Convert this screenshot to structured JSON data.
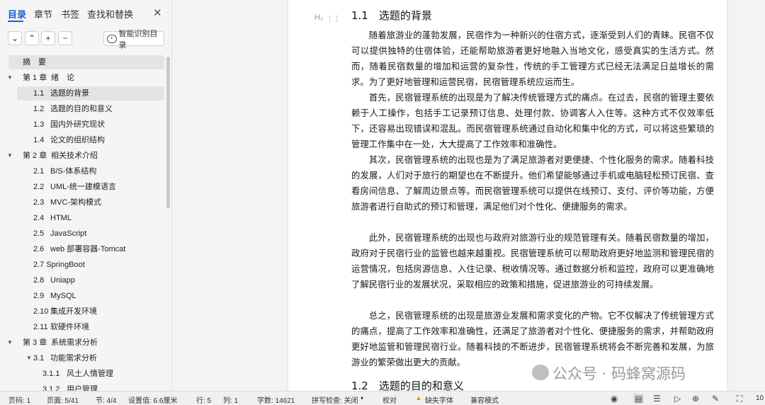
{
  "sidebar": {
    "tabs": [
      "目录",
      "章节",
      "书签",
      "查找和替换"
    ],
    "close": "✕",
    "smart_button": "智能识别目录",
    "toc": [
      {
        "num": "",
        "text": "摘　要",
        "indent": 0,
        "caret": false,
        "selected": false,
        "shaded": true
      },
      {
        "num": "第 1 章",
        "text": "绪　论",
        "indent": 1,
        "caret": true,
        "selected": false
      },
      {
        "num": "1.1",
        "text": "选题的背景",
        "indent": 2,
        "caret": false,
        "selected": true
      },
      {
        "num": "1.2",
        "text": "选题的目的和意义",
        "indent": 2,
        "caret": false,
        "selected": false
      },
      {
        "num": "1.3",
        "text": "国内外研究现状",
        "indent": 2,
        "caret": false,
        "selected": false
      },
      {
        "num": "1.4",
        "text": "论文的组织结构",
        "indent": 2,
        "caret": false,
        "selected": false
      },
      {
        "num": "第 2 章",
        "text": "相关技术介绍",
        "indent": 1,
        "caret": true,
        "selected": false
      },
      {
        "num": "2.1",
        "text": "B/S-体系结构",
        "indent": 2,
        "caret": false,
        "selected": false
      },
      {
        "num": "2.2",
        "text": "UML-统一建模语言",
        "indent": 2,
        "caret": false,
        "selected": false
      },
      {
        "num": "2.3",
        "text": "MVC-架构模式",
        "indent": 2,
        "caret": false,
        "selected": false
      },
      {
        "num": "2.4",
        "text": "HTML",
        "indent": 2,
        "caret": false,
        "selected": false
      },
      {
        "num": "2.5",
        "text": "JavaScript",
        "indent": 2,
        "caret": false,
        "selected": false
      },
      {
        "num": "2.6",
        "text": "web 部署容器-Tomcat",
        "indent": 2,
        "caret": false,
        "selected": false
      },
      {
        "num": "",
        "text": "2.7 SpringBoot",
        "indent": 2,
        "caret": false,
        "selected": false
      },
      {
        "num": "2.8",
        "text": "Uniapp",
        "indent": 2,
        "caret": false,
        "selected": false
      },
      {
        "num": "2.9",
        "text": "MySQL",
        "indent": 2,
        "caret": false,
        "selected": false
      },
      {
        "num": "2.10",
        "text": "集成开发环境",
        "indent": 2,
        "caret": false,
        "selected": false
      },
      {
        "num": "2.11",
        "text": "软硬件环境",
        "indent": 2,
        "caret": false,
        "selected": false
      },
      {
        "num": "第 3 章",
        "text": "系统需求分析",
        "indent": 1,
        "caret": true,
        "selected": false
      },
      {
        "num": "3.1",
        "text": "功能需求分析",
        "indent": 2,
        "caret": true,
        "selected": false
      },
      {
        "num": "3.1.1",
        "text": "风土人情管理",
        "indent": 3,
        "caret": false,
        "selected": false
      },
      {
        "num": "3.1.2",
        "text": "用户管理",
        "indent": 3,
        "caret": false,
        "selected": false
      }
    ]
  },
  "document": {
    "heading_marker": "H₂",
    "heading1": "1.1　选题的背景",
    "paragraphs": [
      "随着旅游业的蓬勃发展，民宿作为一种新兴的住宿方式，逐渐受到人们的青睐。民宿不仅可以提供独特的住宿体验，还能帮助旅游者更好地融入当地文化，感受真实的生活方式。然而，随着民宿数量的增加和运营的复杂性，传统的手工管理方式已经无法满足日益增长的需求。为了更好地管理和运营民宿，民宿管理系统应运而生。",
      "首先，民宿管理系统的出现是为了解决传统管理方式的痛点。在过去，民宿的管理主要依赖于人工操作，包括手工记录预订信息、处理付款、协调客人入住等。这种方式不仅效率低下，还容易出现错误和混乱。而民宿管理系统通过自动化和集中化的方式，可以将这些繁琐的管理工作集中在一处，大大提高了工作效率和准确性。",
      "其次，民宿管理系统的出现也是为了满足旅游者对更便捷、个性化服务的需求。随着科技的发展，人们对于旅行的期望也在不断提升。他们希望能够通过手机或电脑轻松预订民宿、查看房间信息、了解周边景点等。而民宿管理系统可以提供在线预订、支付、评价等功能，方便旅游者进行自助式的预订和管理，满足他们对个性化、便捷服务的需求。",
      "此外，民宿管理系统的出现也与政府对旅游行业的规范管理有关。随着民宿数量的增加，政府对于民宿行业的监管也越来越重视。民宿管理系统可以帮助政府更好地监测和管理民宿的运营情况，包括房源信息、入住记录、税收情况等。通过数据分析和监控，政府可以更准确地了解民宿行业的发展状况，采取相应的政策和措施，促进旅游业的可持续发展。",
      "总之，民宿管理系统的出现是旅游业发展和需求变化的产物。它不仅解决了传统管理方式的痛点，提高了工作效率和准确性，还满足了旅游者对个性化、便捷服务的需求，并帮助政府更好地监管和管理民宿行业。随着科技的不断进步，民宿管理系统将会不断完善和发展，为旅游业的繁荣做出更大的贡献。"
    ],
    "heading2": "1.2　选题的目的和意义",
    "watermark": "公众号 · 码蜂窝源码"
  },
  "status": {
    "page_code": "页码: 1",
    "page": "页面: 5/41",
    "section": "节: 4/4",
    "setting": "设置值: 6.6厘米",
    "row": "行: 5",
    "col": "列: 1",
    "words": "字数: 14621",
    "spell": "拼写检查: 关闭",
    "proof": "校对",
    "missing_font": "缺失字体",
    "compat": "兼容模式",
    "zoom": "10"
  },
  "colors": {
    "accent": "#1a5fd6",
    "warning": "#e0a000"
  }
}
